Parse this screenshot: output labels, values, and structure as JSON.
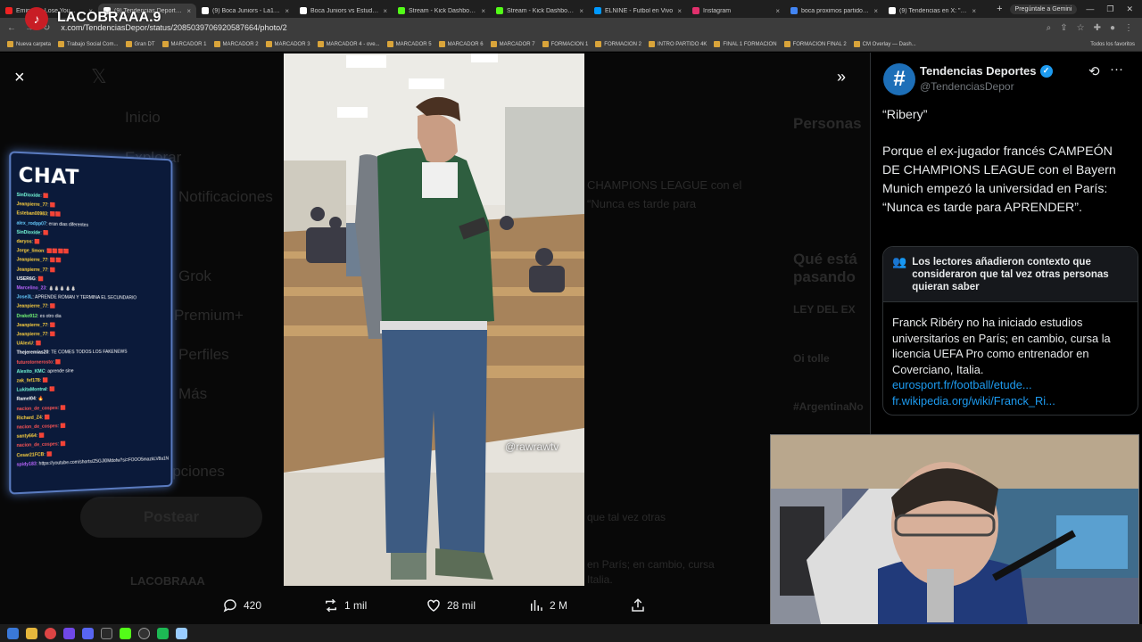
{
  "browser": {
    "tabs": [
      {
        "label": "Eminem - Lose You...",
        "color": "#e22"
      },
      {
        "label": "(9) Tendencias Deportes en...",
        "color": "#fff",
        "active": true
      },
      {
        "label": "(9) Boca Juniors - La12Tuit...",
        "color": "#fff"
      },
      {
        "label": "Boca Juniors vs Estudiantes...",
        "color": "#fff"
      },
      {
        "label": "Stream - Kick Dashboard",
        "color": "#53fc18"
      },
      {
        "label": "Stream - Kick Dashboard",
        "color": "#53fc18"
      },
      {
        "label": "ELNINE - Futbol en Vivo",
        "color": "#09f"
      },
      {
        "label": "Instagram",
        "color": "#e1306c"
      },
      {
        "label": "boca proximos partidos - ...",
        "color": "#4285f4"
      },
      {
        "label": "(9) Tendencias en X: \"Em...",
        "color": "#fff"
      }
    ],
    "new_tab": "+",
    "gemini": "Pregúntale a Gemini",
    "url": "x.com/TendenciasDepor/status/2085039706920587664/photo/2",
    "bookmarks": [
      "Nueva carpeta",
      "Trabajo Social Com...",
      "Gran DT",
      "MARCADOR 1",
      "MARCADOR 2",
      "MARCADOR 3",
      "MARCADOR 4 - ove...",
      "MARCADOR 5",
      "MARCADOR 6",
      "MARCADOR 7",
      "FORMACION 1",
      "FORMACION 2",
      "INTRO PARTIDO 4K",
      "FINAL 1 FORMACION",
      "FORMACION FINAL 2",
      "CM Overlay — Dash..."
    ],
    "bookmarks_all": "Todos los favoritos"
  },
  "stream_overlay": {
    "name": "LACOBRAAA.9"
  },
  "viewer": {
    "close": "×",
    "expand": "»",
    "watermark": "@rawrawtv"
  },
  "actions": {
    "replies": "420",
    "reposts": "1 mil",
    "likes": "28 mil",
    "views": "2 M"
  },
  "chat": {
    "title": "CHAT",
    "messages": [
      {
        "user": "SinDioxide",
        "color": "#7fd",
        "text": ": 🟥"
      },
      {
        "user": "Jeanpierre_77",
        "color": "#ffd23f",
        "text": ": 🟥"
      },
      {
        "user": "Esteban00983",
        "color": "#ffd23f",
        "text": ": 🟥🟥"
      },
      {
        "user": "alex_rodpp07",
        "color": "#6cf",
        "text": ": eran dias diferentes"
      },
      {
        "user": "SinDioxide",
        "color": "#7fd",
        "text": ": 🟥"
      },
      {
        "user": "daryos",
        "color": "#ffd23f",
        "text": ": 🟥"
      },
      {
        "user": "Jorge_limon",
        "color": "#ffd23f",
        "text": ": 🟥🟥🟥🟥"
      },
      {
        "user": "Jeanpierre_77",
        "color": "#ffd23f",
        "text": ": 🟥🟥"
      },
      {
        "user": "Jeanpierre_77",
        "color": "#ffd23f",
        "text": ": 🟥"
      },
      {
        "user": "USER6G",
        "color": "#fff",
        "text": ": 🟥"
      },
      {
        "user": "Marcelino_23",
        "color": "#b6f",
        "text": ": ⛄⛄⛄⛄⛄"
      },
      {
        "user": "Jose3L",
        "color": "#6cf",
        "text": ": APRENDE ROMAN Y TERMINA EL SECUNDARIO"
      },
      {
        "user": "Jeanpierre_77",
        "color": "#ffd23f",
        "text": ": 🟥"
      },
      {
        "user": "Drako912",
        "color": "#7f7",
        "text": ": es otro dia"
      },
      {
        "user": "Jeanpierre_77",
        "color": "#ffd23f",
        "text": ": 🟥"
      },
      {
        "user": "Jeanpierre_77",
        "color": "#ffd23f",
        "text": ": 🟥"
      },
      {
        "user": "UAlexU",
        "color": "#ffd23f",
        "text": ": 🟥"
      },
      {
        "user": "Thejeremias20",
        "color": "#fff",
        "text": ": TE COMES TODOS LOS FAKENEWS"
      },
      {
        "user": "futurotornerosto",
        "color": "#f55",
        "text": ": 🟥"
      },
      {
        "user": "Alexito_KMC",
        "color": "#7fd",
        "text": ": aprende sine"
      },
      {
        "user": "zak_fef178",
        "color": "#ffd23f",
        "text": ": 🟥"
      },
      {
        "user": "LukitaMontral",
        "color": "#7fd",
        "text": ": 🟥"
      },
      {
        "user": "Ramel04",
        "color": "#fff",
        "text": ": 🔥"
      },
      {
        "user": "nacion_de_cospes",
        "color": "#f55",
        "text": ": 🟥"
      },
      {
        "user": "Richard_Z4",
        "color": "#ffd23f",
        "text": ": 🟥"
      },
      {
        "user": "nacion_de_cospes",
        "color": "#f55",
        "text": ": 🟥"
      },
      {
        "user": "santy664",
        "color": "#ffd23f",
        "text": ": 🟥"
      },
      {
        "user": "nacion_de_cospes",
        "color": "#f55",
        "text": ": 🟥"
      },
      {
        "user": "Cesar21FCB",
        "color": "#ffd23f",
        "text": ": 🟥"
      },
      {
        "user": "spidy183",
        "color": "#b6f",
        "text": ": https://youtube.com/shorts/Z5GJl0Mdofw?si=FOOO5mazkLV8a1N"
      }
    ]
  },
  "sidebar": {
    "display_name": "Tendencias Deportes",
    "handle": "@TendenciasDepor",
    "avatar_glyph": "#",
    "tweet_quote": "“Ribery”",
    "tweet_body": "Porque el ex-jugador francés CAMPEÓN DE CHAMPIONS LEAGUE con el Bayern Munich empezó la universidad en París: “Nunca es tarde para APRENDER”.",
    "note_header": "Los lectores añadieron contexto que consideraron que tal vez otras personas quieran saber",
    "note_body": "Franck Ribéry no ha iniciado estudios universitarios en París; en cambio, cursa la licencia UEFA Pro como entrenador en Coverciano, Italia.",
    "note_link1": "eurosport.fr/football/etude...",
    "note_link2": "fr.wikipedia.org/wiki/Franck_Ri..."
  },
  "background_ghost": {
    "nav": [
      "Inicio",
      "Explorar",
      "Notificaciones",
      "Grok",
      "Premium+",
      "Perfiles",
      "Más",
      "Opciones"
    ],
    "post_button": "Postear",
    "account": "LACOBRAAA",
    "right_title": "Personas",
    "trends_title": "Qué está pasando",
    "trend1": "LEY DEL EX",
    "trend2": "Oi tolle",
    "trend3": "#ArgentinaNo",
    "bg_text1": "CHAMPIONS LEAGUE con el",
    "bg_text2": "“Nunca es tarde para",
    "bg_text3": "que tal vez otras",
    "bg_text4": "en París; en cambio, cursa",
    "bg_text5": "Italia."
  }
}
